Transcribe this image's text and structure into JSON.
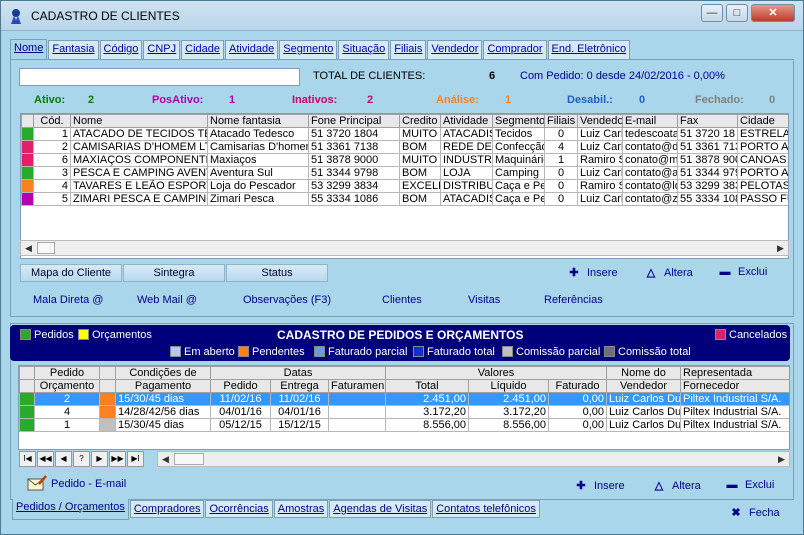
{
  "window": {
    "title": "CADASTRO DE CLIENTES",
    "min_label": "—",
    "max_label": "□",
    "close_label": "✕"
  },
  "tabs": [
    {
      "label": "Nome",
      "active": true
    },
    {
      "label": "Fantasia"
    },
    {
      "label": "Código"
    },
    {
      "label": "CNPJ"
    },
    {
      "label": "Cidade"
    },
    {
      "label": "Atividade"
    },
    {
      "label": "Segmento"
    },
    {
      "label": "Situação"
    },
    {
      "label": "Filiais"
    },
    {
      "label": "Vendedor"
    },
    {
      "label": "Comprador"
    },
    {
      "label": "End. Eletrônico"
    }
  ],
  "search": {
    "value": ""
  },
  "summary": {
    "total_label": "TOTAL DE CLIENTES:",
    "total_value": "6",
    "pedido_text": "Com Pedido: 0 desde 24/02/2016 -  0,00%"
  },
  "status_counts": [
    {
      "label": "Ativo:",
      "value": "2",
      "color": "#008000"
    },
    {
      "label": "PosAtivo:",
      "value": "1",
      "color": "#b000b0"
    },
    {
      "label": "Inativos:",
      "value": "2",
      "color": "#d4006a"
    },
    {
      "label": "Análise:",
      "value": "1",
      "color": "#ff8020"
    },
    {
      "label": "Desabil.:",
      "value": "0",
      "color": "#2060c0"
    },
    {
      "label": "Fechado:",
      "value": "0",
      "color": "#808080"
    }
  ],
  "clients_table": {
    "columns": [
      "Cód.",
      "Nome",
      "Nome fantasia",
      "Fone Principal",
      "Credito",
      "Atividade",
      "Segmento",
      "Filiais",
      "Vendedor",
      "E-mail",
      "Fax",
      "Cidade"
    ],
    "rows": [
      {
        "status_color": "#2aaa2a",
        "cells": [
          "1",
          "ATACADO DE TECIDOS TE",
          "Atacado Tedesco",
          "51 3720 1804",
          "MUITO B",
          "ATACADIS",
          "Tecidos",
          "0",
          "Luiz Carlo",
          "tedescoatad",
          "51 3720 18",
          "ESTRELA"
        ]
      },
      {
        "status_color": "#e0206a",
        "cells": [
          "2",
          "CAMISARIAS D'HOMEM LT",
          "Camisarias D'homem",
          "51 3361 7138",
          "BOM",
          "REDE DE",
          "Confecção",
          "4",
          "Luiz Carlo",
          "contato@dh",
          "51 3361 713",
          "PORTO A"
        ]
      },
      {
        "status_color": "#e0206a",
        "cells": [
          "6",
          "MAXIAÇOS COMPONENTE",
          "Maxiaços",
          "51 3878 9000",
          "MUITO B",
          "INDÚSTRIA",
          "Maquinário",
          "1",
          "Ramiro S",
          "conato@ma",
          "51 3878 900",
          "CANOAS"
        ]
      },
      {
        "status_color": "#2aaa2a",
        "cells": [
          "3",
          "PESCA E CAMPING AVENT",
          "Aventura Sul",
          "51 3344 9798",
          "BOM",
          "LOJA",
          "Camping",
          "0",
          "Luiz Carlo",
          "contato@av",
          "51 3344 979",
          "PORTO A"
        ]
      },
      {
        "status_color": "#ff8020",
        "cells": [
          "4",
          "TAVARES E LEÃO ESPORT",
          "Loja do Pescador",
          "53 3299 3834",
          "EXCELE",
          "DISTRIBU",
          "Caça e Pe",
          "0",
          "Ramiro S",
          "contato@lo",
          "53 3299 383",
          "PELOTAS"
        ]
      },
      {
        "status_color": "#b000b0",
        "cells": [
          "5",
          "ZIMARI PESCA E CAMPING",
          "Zimari Pesca",
          "55 3334 1086",
          "BOM",
          "ATACADIS",
          "Caça e Pe",
          "0",
          "Luiz Carlo",
          "contato@zi",
          "55 3334 108",
          "PASSO FU"
        ]
      }
    ]
  },
  "client_buttons": {
    "map": "Mapa do Cliente",
    "sintegra": "Sintegra",
    "status": "Status"
  },
  "client_actions": {
    "insert": "Insere",
    "edit": "Altera",
    "delete": "Exclui"
  },
  "client_links": [
    "Mala Direta @",
    "Web Mail @",
    "Observações (F3)",
    "Clientes",
    "Visitas",
    "Referências"
  ],
  "orders_header": {
    "pedidos": "Pedidos",
    "orcamentos": "Orçamentos",
    "title": "CADASTRO DE PEDIDOS E ORÇAMENTOS",
    "cancelados": "Cancelados",
    "legend": [
      {
        "label": "Em aberto",
        "color": "#b8c8f0"
      },
      {
        "label": "Pendentes",
        "color": "#ff8020"
      },
      {
        "label": "Faturado parcial",
        "color": "#6a9ae0"
      },
      {
        "label": "Faturado total",
        "color": "#1030d0"
      },
      {
        "label": "Comissão parcial",
        "color": "#c0c0c0"
      },
      {
        "label": "Comissão total",
        "color": "#707070"
      }
    ]
  },
  "orders_table": {
    "group_headers": {
      "pedido": "Pedido",
      "condicoes": "Condições de",
      "datas": "Datas",
      "valores": "Valores",
      "nome": "Nome do",
      "representada": "Representada"
    },
    "sub_headers": {
      "orcamento": "Orçamento",
      "pagamento": "Pagamento",
      "pedido": "Pedido",
      "entrega": "Entrega",
      "faturamento": "Faturamen.",
      "total": "Total",
      "liquido": "Líquido",
      "faturado": "Faturado",
      "vendedor": "Vendedor",
      "fornecedor": "Fornecedor"
    },
    "rows": [
      {
        "selected": true,
        "color1": "#2aaa2a",
        "color2": "#ff8020",
        "cells": [
          "2",
          "15/30/45 dias",
          "11/02/16",
          "11/02/16",
          "",
          "2.451,00",
          "2.451,00",
          "0,00",
          "Luiz Carlos Du",
          "Piltex Industrial S/A."
        ]
      },
      {
        "selected": false,
        "color1": "#2aaa2a",
        "color2": "#ff8020",
        "cells": [
          "4",
          "14/28/42/56 dias",
          "04/01/16",
          "04/01/16",
          "",
          "3.172,20",
          "3.172,20",
          "0,00",
          "Luiz Carlos Du",
          "Piltex Industrial S/A."
        ]
      },
      {
        "selected": false,
        "color1": "#2aaa2a",
        "color2": "#c0c0c0",
        "cells": [
          "1",
          "15/30/45 dias",
          "05/12/15",
          "15/12/15",
          "",
          "8.556,00",
          "8.556,00",
          "0,00",
          "Luiz Carlos Du",
          "Piltex Industrial S/A."
        ]
      }
    ]
  },
  "nav_buttons": [
    "I◀",
    "◀◀",
    "◀",
    "?",
    "▶",
    "▶▶",
    "▶I"
  ],
  "order_link": "Pedido - E-mail",
  "order_actions": {
    "insert": "Insere",
    "edit": "Altera",
    "delete": "Exclui"
  },
  "bottom_tabs": [
    "Pedidos / Orçamentos",
    "Compradores",
    "Ocorrências",
    "Amostras",
    "Agendas de Visitas",
    "Contatos telefônicos"
  ],
  "close_button": "Fecha"
}
